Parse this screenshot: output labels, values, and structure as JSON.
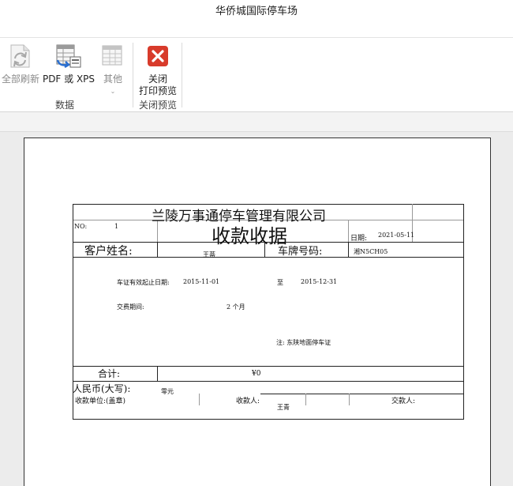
{
  "window": {
    "title": "华侨城国际停车场"
  },
  "ribbon": {
    "refresh_all": "全部刷新",
    "export_pdf_xps": "PDF 或 XPS",
    "other": "其他",
    "close_preview_line1": "关闭",
    "close_preview_line2": "打印预览",
    "group_data": "数据",
    "group_close_preview": "关闭预览"
  },
  "receipt": {
    "company": "兰陵万事通停车管理有限公司",
    "no_label": "NO:",
    "no_value": "1",
    "title": "收款收据",
    "date_label": "日期:",
    "date_value": "2021-05-11",
    "customer_label": "客户姓名:",
    "customer_value": "王蒂",
    "plate_label": "车牌号码:",
    "plate_value": "湘N5CH05",
    "validity_label": "车证有效起止日期:",
    "validity_start": "2015-11-01",
    "validity_to": "至",
    "validity_end": "2015-12-31",
    "period_label": "交费期间:",
    "period_value": "2 个月",
    "note": "注: 东陕地面停车证",
    "total_label": "合计:",
    "total_value": "¥0",
    "rmb_upper_label": "人民币(大写):",
    "rmb_upper_value": "零元",
    "payee_unit_label": "收款单位:(盖章)",
    "payee_label": "收款人:",
    "payee_value": "王青",
    "payer_label": "交款人:"
  }
}
